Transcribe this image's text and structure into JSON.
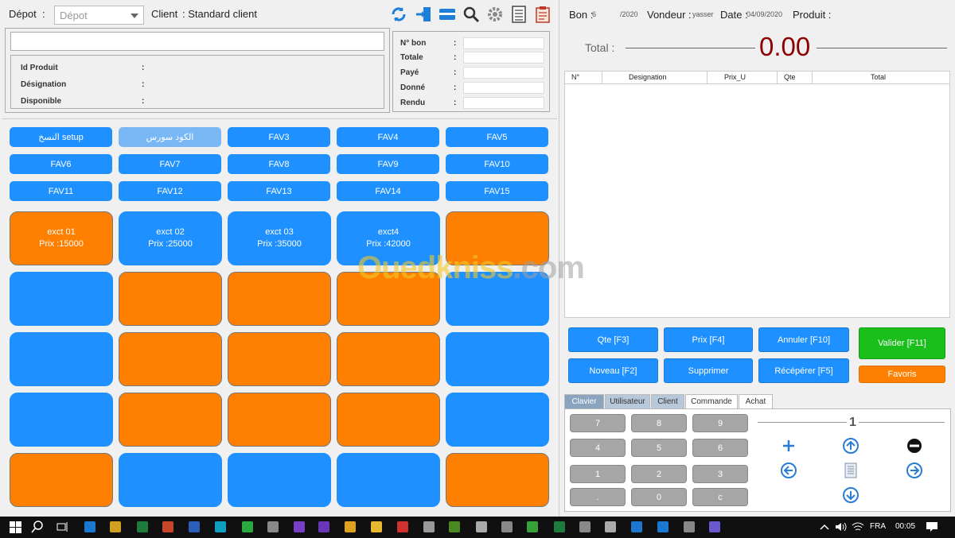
{
  "header": {
    "depot_label": "Dépot",
    "depot_colon": ":",
    "depot_placeholder": "Dépot",
    "client_label": "Client",
    "client_value": ": Standard client"
  },
  "toolbar_icons": [
    "refresh-icon",
    "export-icon",
    "card-icon",
    "search-icon",
    "gear-icon",
    "list-icon",
    "clipboard-icon"
  ],
  "product_panel": {
    "fields": [
      {
        "label": "Id Produit",
        "colon": ":"
      },
      {
        "label": "Désignation",
        "colon": ":"
      },
      {
        "label": "Disponible",
        "colon": ":"
      }
    ]
  },
  "bon_panel": {
    "fields": [
      {
        "label": "N° bon",
        "colon": ":"
      },
      {
        "label": "Totale",
        "colon": ":"
      },
      {
        "label": "Payé",
        "colon": ":"
      },
      {
        "label": "Donné",
        "colon": ":"
      },
      {
        "label": "Rendu",
        "colon": ":"
      }
    ]
  },
  "fav_buttons": [
    "النسخ setup",
    "الكود سورس",
    "FAV3",
    "FAV4",
    "FAV5",
    "FAV6",
    "FAV7",
    "FAV8",
    "FAV9",
    "FAV10",
    "FAV11",
    "FAV12",
    "FAV13",
    "FAV14",
    "FAV15"
  ],
  "tiles": [
    {
      "color": "orange",
      "line1": "exct 01",
      "line2": "Prix :15000"
    },
    {
      "color": "blue",
      "line1": "exct 02",
      "line2": "Prix :25000"
    },
    {
      "color": "blue",
      "line1": "exct 03",
      "line2": "Prix :35000"
    },
    {
      "color": "blue",
      "line1": "exct4",
      "line2": "Prix :42000"
    },
    {
      "color": "orange",
      "line1": "",
      "line2": ""
    },
    {
      "color": "blue",
      "line1": "",
      "line2": ""
    },
    {
      "color": "orange",
      "line1": "",
      "line2": ""
    },
    {
      "color": "orange",
      "line1": "",
      "line2": ""
    },
    {
      "color": "orange",
      "line1": "",
      "line2": ""
    },
    {
      "color": "blue",
      "line1": "",
      "line2": ""
    },
    {
      "color": "blue",
      "line1": "",
      "line2": ""
    },
    {
      "color": "orange",
      "line1": "",
      "line2": ""
    },
    {
      "color": "orange",
      "line1": "",
      "line2": ""
    },
    {
      "color": "orange",
      "line1": "",
      "line2": ""
    },
    {
      "color": "blue",
      "line1": "",
      "line2": ""
    },
    {
      "color": "blue",
      "line1": "",
      "line2": ""
    },
    {
      "color": "orange",
      "line1": "",
      "line2": ""
    },
    {
      "color": "orange",
      "line1": "",
      "line2": ""
    },
    {
      "color": "orange",
      "line1": "",
      "line2": ""
    },
    {
      "color": "blue",
      "line1": "",
      "line2": ""
    },
    {
      "color": "orange",
      "line1": "",
      "line2": ""
    },
    {
      "color": "blue",
      "line1": "",
      "line2": ""
    },
    {
      "color": "blue",
      "line1": "",
      "line2": ""
    },
    {
      "color": "blue",
      "line1": "",
      "line2": ""
    },
    {
      "color": "orange",
      "line1": "",
      "line2": ""
    }
  ],
  "right_header": {
    "bon_label": "Bon :",
    "bon_num": "6",
    "bon_year": "/2020",
    "vendeur_label": "Vondeur :",
    "vendeur_value": "yasser",
    "date_label": "Date :",
    "date_value": "04/09/2020",
    "produit_label": "Produit :"
  },
  "total": {
    "label": "Total :",
    "value": "0.00"
  },
  "table": {
    "columns": [
      "N°",
      "Designation",
      "Prix_U",
      "Qte",
      "Total"
    ]
  },
  "actions": {
    "qte": "Qte [F3]",
    "prix": "Prix [F4]",
    "annuler": "Annuler [F10]",
    "valider": "Valider [F11]",
    "nouveau": "Noveau [F2]",
    "supprimer": "Supprimer",
    "recuperer": "Récépérer [F5]",
    "favoris": "Favoris"
  },
  "tabs": [
    "Clavier",
    "Utilisateur",
    "Client",
    "Commande",
    "Achat"
  ],
  "keypad": [
    "7",
    "8",
    "9",
    "4",
    "5",
    "6",
    "1",
    "2",
    "3",
    ".",
    "0",
    "c"
  ],
  "quantity_display": "1",
  "watermark": {
    "main": "Ouedkniss",
    "suffix": ".com"
  },
  "taskbar": {
    "lang": "FRA",
    "time": "00:05"
  },
  "colors": {
    "blue": "#1e90ff",
    "orange": "#ff8000",
    "green": "#1bbf1b",
    "total_red": "#8b0000"
  }
}
